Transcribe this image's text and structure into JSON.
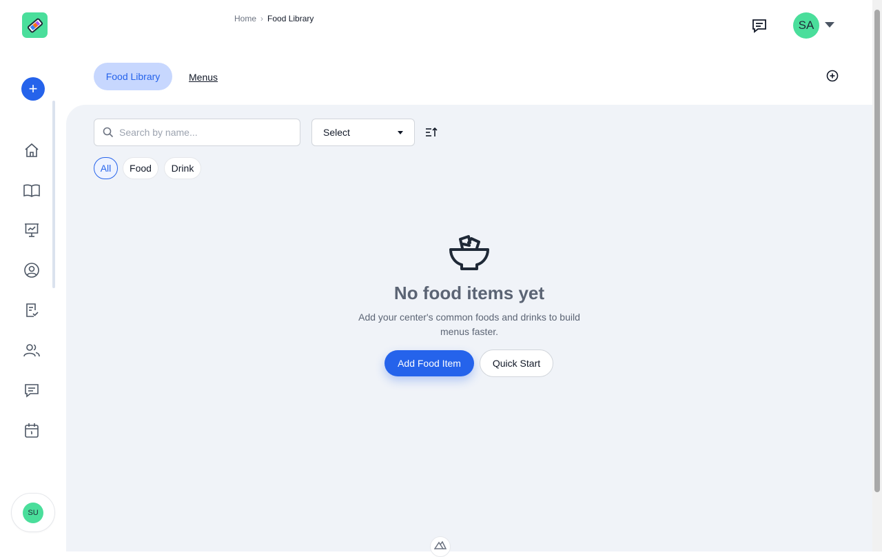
{
  "breadcrumb": {
    "home": "Home",
    "separator": "›",
    "current": "Food Library"
  },
  "header": {
    "avatar_initials": "SA"
  },
  "sidebar": {
    "add_label": "+",
    "items": [
      "home-icon",
      "book-icon",
      "presentation-chart-icon",
      "user-circle-icon",
      "clipboard-check-icon",
      "users-icon",
      "chat-icon",
      "calendar-icon"
    ],
    "user_initials": "SU"
  },
  "tabs": {
    "active": "Food Library",
    "other": "Menus"
  },
  "filters": {
    "search_placeholder": "Search by name...",
    "select_value": "Select",
    "chips": [
      "All",
      "Food",
      "Drink"
    ]
  },
  "empty_state": {
    "title": "No food items yet",
    "description": "Add your center's common foods and drinks to build menus faster.",
    "primary_button": "Add Food Item",
    "secondary_button": "Quick Start"
  },
  "colors": {
    "accent": "#2563eb",
    "brand": "#4ade9b",
    "background": "#f0f3f8"
  }
}
